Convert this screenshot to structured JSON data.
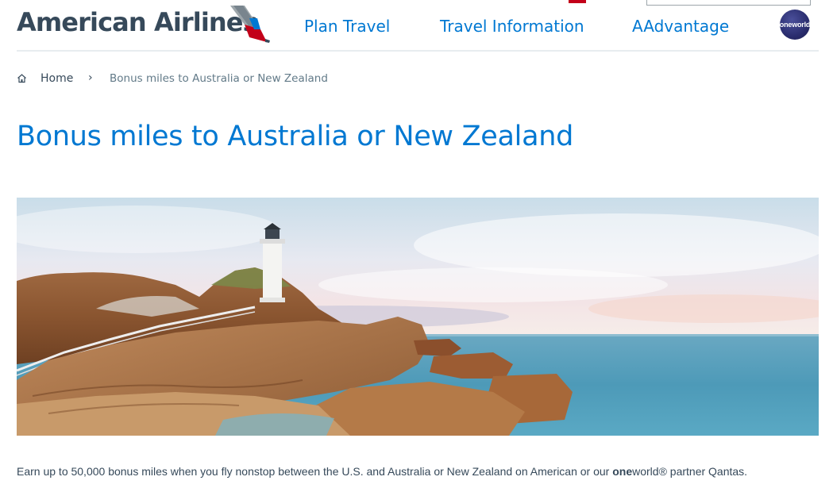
{
  "header": {
    "brand_name": "American Airlines",
    "nav": [
      {
        "label": "Plan Travel"
      },
      {
        "label": "Travel Information"
      },
      {
        "label": "AAdvantage"
      }
    ],
    "alliance_badge": "oneworld",
    "icons": {
      "logo": "aa-flight-symbol-icon",
      "search": "search-icon",
      "flag": "us-flag-icon",
      "alliance": "oneworld-logo-icon"
    }
  },
  "breadcrumb": {
    "home_label": "Home",
    "separator": "›",
    "current": "Bonus miles to Australia or New Zealand"
  },
  "page": {
    "title": "Bonus miles to Australia or New Zealand"
  },
  "hero": {
    "image_subject": "Lighthouse on rocky coastline by the sea"
  },
  "promo": {
    "text_before": "Earn up to 50,000 bonus miles when you fly nonstop between the U.S. and Australia or New Zealand on American or our ",
    "brand_bold": "one",
    "text_after": "world® partner Qantas."
  },
  "colors": {
    "brand_blue": "#0078d2",
    "text_dark": "#36495a",
    "brand_red": "#c30019"
  }
}
